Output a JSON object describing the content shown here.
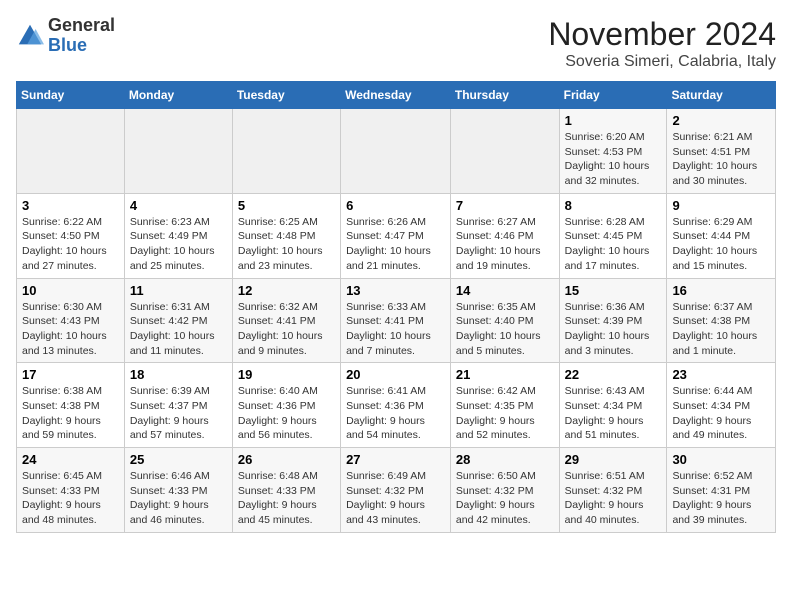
{
  "header": {
    "logo_general": "General",
    "logo_blue": "Blue",
    "month_title": "November 2024",
    "subtitle": "Soveria Simeri, Calabria, Italy"
  },
  "days_of_week": [
    "Sunday",
    "Monday",
    "Tuesday",
    "Wednesday",
    "Thursday",
    "Friday",
    "Saturday"
  ],
  "weeks": [
    [
      {
        "day": "",
        "info": ""
      },
      {
        "day": "",
        "info": ""
      },
      {
        "day": "",
        "info": ""
      },
      {
        "day": "",
        "info": ""
      },
      {
        "day": "",
        "info": ""
      },
      {
        "day": "1",
        "info": "Sunrise: 6:20 AM\nSunset: 4:53 PM\nDaylight: 10 hours and 32 minutes."
      },
      {
        "day": "2",
        "info": "Sunrise: 6:21 AM\nSunset: 4:51 PM\nDaylight: 10 hours and 30 minutes."
      }
    ],
    [
      {
        "day": "3",
        "info": "Sunrise: 6:22 AM\nSunset: 4:50 PM\nDaylight: 10 hours and 27 minutes."
      },
      {
        "day": "4",
        "info": "Sunrise: 6:23 AM\nSunset: 4:49 PM\nDaylight: 10 hours and 25 minutes."
      },
      {
        "day": "5",
        "info": "Sunrise: 6:25 AM\nSunset: 4:48 PM\nDaylight: 10 hours and 23 minutes."
      },
      {
        "day": "6",
        "info": "Sunrise: 6:26 AM\nSunset: 4:47 PM\nDaylight: 10 hours and 21 minutes."
      },
      {
        "day": "7",
        "info": "Sunrise: 6:27 AM\nSunset: 4:46 PM\nDaylight: 10 hours and 19 minutes."
      },
      {
        "day": "8",
        "info": "Sunrise: 6:28 AM\nSunset: 4:45 PM\nDaylight: 10 hours and 17 minutes."
      },
      {
        "day": "9",
        "info": "Sunrise: 6:29 AM\nSunset: 4:44 PM\nDaylight: 10 hours and 15 minutes."
      }
    ],
    [
      {
        "day": "10",
        "info": "Sunrise: 6:30 AM\nSunset: 4:43 PM\nDaylight: 10 hours and 13 minutes."
      },
      {
        "day": "11",
        "info": "Sunrise: 6:31 AM\nSunset: 4:42 PM\nDaylight: 10 hours and 11 minutes."
      },
      {
        "day": "12",
        "info": "Sunrise: 6:32 AM\nSunset: 4:41 PM\nDaylight: 10 hours and 9 minutes."
      },
      {
        "day": "13",
        "info": "Sunrise: 6:33 AM\nSunset: 4:41 PM\nDaylight: 10 hours and 7 minutes."
      },
      {
        "day": "14",
        "info": "Sunrise: 6:35 AM\nSunset: 4:40 PM\nDaylight: 10 hours and 5 minutes."
      },
      {
        "day": "15",
        "info": "Sunrise: 6:36 AM\nSunset: 4:39 PM\nDaylight: 10 hours and 3 minutes."
      },
      {
        "day": "16",
        "info": "Sunrise: 6:37 AM\nSunset: 4:38 PM\nDaylight: 10 hours and 1 minute."
      }
    ],
    [
      {
        "day": "17",
        "info": "Sunrise: 6:38 AM\nSunset: 4:38 PM\nDaylight: 9 hours and 59 minutes."
      },
      {
        "day": "18",
        "info": "Sunrise: 6:39 AM\nSunset: 4:37 PM\nDaylight: 9 hours and 57 minutes."
      },
      {
        "day": "19",
        "info": "Sunrise: 6:40 AM\nSunset: 4:36 PM\nDaylight: 9 hours and 56 minutes."
      },
      {
        "day": "20",
        "info": "Sunrise: 6:41 AM\nSunset: 4:36 PM\nDaylight: 9 hours and 54 minutes."
      },
      {
        "day": "21",
        "info": "Sunrise: 6:42 AM\nSunset: 4:35 PM\nDaylight: 9 hours and 52 minutes."
      },
      {
        "day": "22",
        "info": "Sunrise: 6:43 AM\nSunset: 4:34 PM\nDaylight: 9 hours and 51 minutes."
      },
      {
        "day": "23",
        "info": "Sunrise: 6:44 AM\nSunset: 4:34 PM\nDaylight: 9 hours and 49 minutes."
      }
    ],
    [
      {
        "day": "24",
        "info": "Sunrise: 6:45 AM\nSunset: 4:33 PM\nDaylight: 9 hours and 48 minutes."
      },
      {
        "day": "25",
        "info": "Sunrise: 6:46 AM\nSunset: 4:33 PM\nDaylight: 9 hours and 46 minutes."
      },
      {
        "day": "26",
        "info": "Sunrise: 6:48 AM\nSunset: 4:33 PM\nDaylight: 9 hours and 45 minutes."
      },
      {
        "day": "27",
        "info": "Sunrise: 6:49 AM\nSunset: 4:32 PM\nDaylight: 9 hours and 43 minutes."
      },
      {
        "day": "28",
        "info": "Sunrise: 6:50 AM\nSunset: 4:32 PM\nDaylight: 9 hours and 42 minutes."
      },
      {
        "day": "29",
        "info": "Sunrise: 6:51 AM\nSunset: 4:32 PM\nDaylight: 9 hours and 40 minutes."
      },
      {
        "day": "30",
        "info": "Sunrise: 6:52 AM\nSunset: 4:31 PM\nDaylight: 9 hours and 39 minutes."
      }
    ]
  ]
}
